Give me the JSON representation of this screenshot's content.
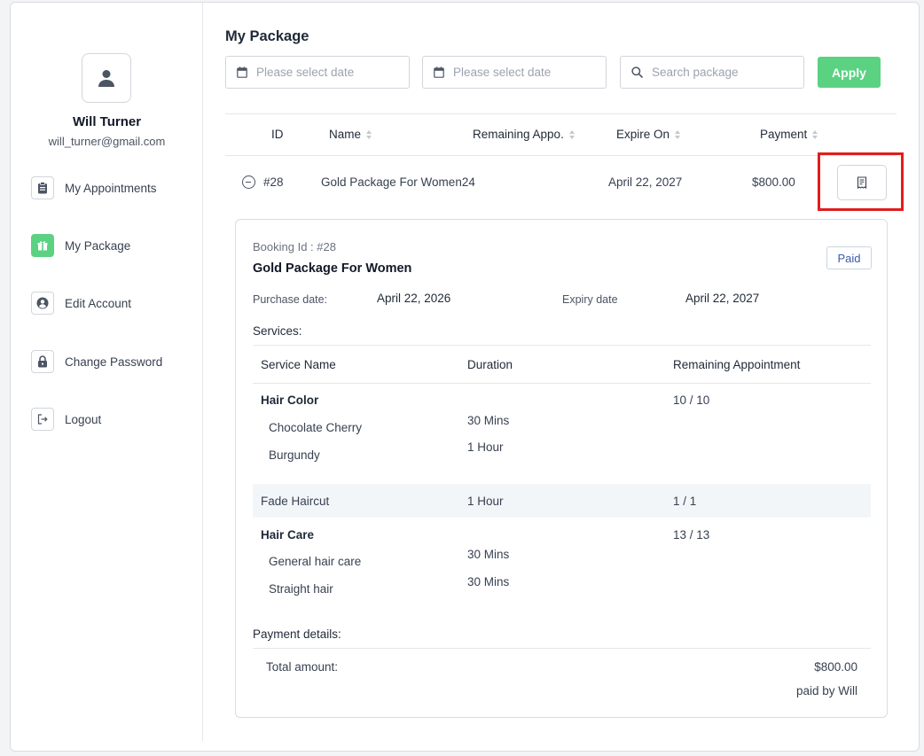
{
  "user": {
    "name": "Will Turner",
    "email": "will_turner@gmail.com"
  },
  "nav": {
    "appointments": "My Appointments",
    "package": "My Package",
    "edit_account": "Edit Account",
    "change_password": "Change Password",
    "logout": "Logout"
  },
  "page": {
    "title": "My Package"
  },
  "filters": {
    "start_date_placeholder": "Please select date",
    "end_date_placeholder": "Please select date",
    "search_placeholder": "Search package",
    "apply_label": "Apply"
  },
  "table": {
    "headers": {
      "id": "ID",
      "name": "Name",
      "remaining": "Remaining Appo.",
      "expire": "Expire On",
      "payment": "Payment"
    },
    "row": {
      "id": "#28",
      "name": "Gold Package For Women24",
      "expire": "April 22, 2027",
      "payment": "$800.00"
    }
  },
  "detail": {
    "booking_id": "Booking Id : #28",
    "package_name": "Gold Package For Women",
    "status": "Paid",
    "purchase_label": "Purchase date:",
    "purchase_value": "April 22, 2026",
    "expiry_label": "Expiry date",
    "expiry_value": "April 22, 2027",
    "services_title": "Services:",
    "services_headers": {
      "name": "Service Name",
      "duration": "Duration",
      "remaining": "Remaining Appointment"
    },
    "groups": [
      {
        "name": "Hair Color",
        "remaining": "10 / 10",
        "items": [
          {
            "name": "Chocolate Cherry",
            "duration": "30 Mins"
          },
          {
            "name": "Burgundy",
            "duration": "1 Hour"
          }
        ]
      },
      {
        "name": "Fade Haircut",
        "duration": "1 Hour",
        "remaining": "1 / 1"
      },
      {
        "name": "Hair Care",
        "remaining": "13 / 13",
        "items": [
          {
            "name": "General hair care",
            "duration": "30 Mins"
          },
          {
            "name": "Straight hair",
            "duration": "30 Mins"
          }
        ]
      }
    ],
    "payment_title": "Payment details:",
    "total_label": "Total amount:",
    "total_value": "$800.00",
    "paid_by": "paid by Will"
  },
  "colors": {
    "accent": "#5ad281",
    "highlight": "#e11d1d",
    "link": "#3b5bab"
  },
  "icons": {
    "avatar": "user-icon",
    "appointments": "clipboard-icon",
    "package": "gift-icon",
    "edit_account": "user-circle-icon",
    "change_password": "lock-icon",
    "logout": "logout-icon",
    "date": "calendar-icon",
    "search": "search-icon",
    "invoice": "receipt-icon",
    "collapse": "minus-circle-icon"
  }
}
